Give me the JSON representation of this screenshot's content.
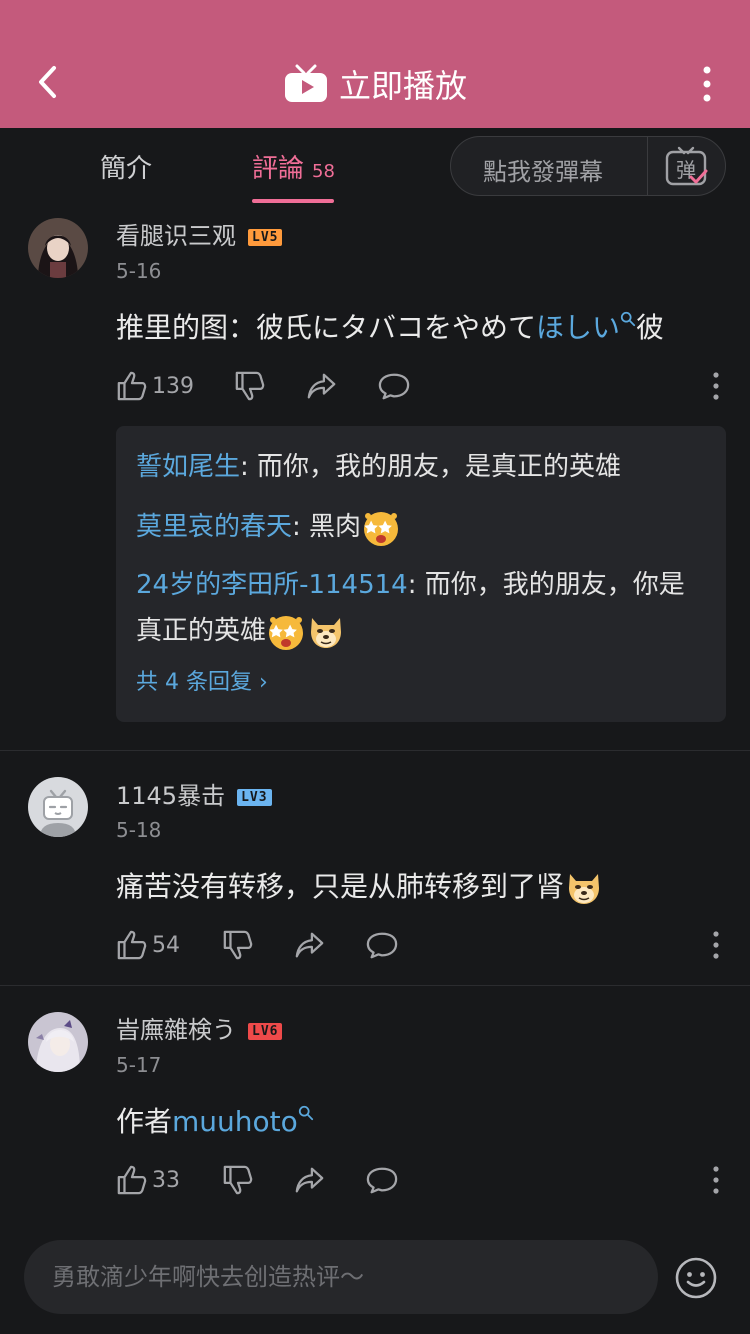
{
  "header": {
    "title": "立即播放",
    "colors": {
      "bar": "#c45a7c",
      "accent": "#f06e97",
      "link": "#5ba8dd"
    }
  },
  "tabs": {
    "intro_label": "簡介",
    "comments_label": "評論",
    "comments_count": "58",
    "danmaku_placeholder": "點我發彈幕",
    "danmaku_icon_char": "弹"
  },
  "comments": [
    {
      "username": "看腿识三观",
      "level": "LV5",
      "date": "5-16",
      "text_plain": "推里的图：彼氏にタバコをやめて",
      "text_link": "ほしい",
      "text_after": "彼",
      "likes": "139",
      "replies": [
        {
          "name": "誓如尾生",
          "text": ": 而你，我的朋友，是真正的英雄"
        },
        {
          "name": "莫里哀的春天",
          "text": ": 黑肉"
        },
        {
          "name": "24岁的李田所-114514",
          "text": ": 而你，我的朋友，你是真正的英雄"
        }
      ],
      "more_replies": "共 4 条回复 ›"
    },
    {
      "username": "1145暴击",
      "level": "LV3",
      "date": "5-18",
      "text_plain": "痛苦没有转移，只是从肺转移到了肾",
      "likes": "54"
    },
    {
      "username": "峕廡雜検う",
      "level": "LV6",
      "date": "5-17",
      "text_plain": "作者",
      "text_link": "muuhoto",
      "likes": "33"
    }
  ],
  "compose": {
    "placeholder": "勇敢滴少年啊快去创造热评～"
  }
}
